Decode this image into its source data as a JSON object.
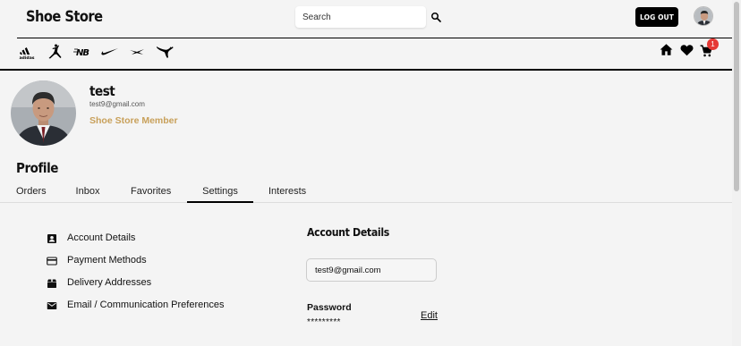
{
  "header": {
    "logo": "Shoe Store",
    "search_placeholder": "Search",
    "logout_label": "LOG OUT"
  },
  "brands": [
    {
      "name": "adidas",
      "icon": "adidas-logo",
      "text": "adidas"
    },
    {
      "name": "jordan",
      "icon": "jumpman-logo"
    },
    {
      "name": "new-balance",
      "icon": "new-balance-logo",
      "text": "NB"
    },
    {
      "name": "nike",
      "icon": "nike-swoosh-logo"
    },
    {
      "name": "reebok",
      "icon": "reebok-logo"
    },
    {
      "name": "puma",
      "icon": "puma-logo"
    }
  ],
  "nav_icons": [
    "home-icon",
    "heart-icon",
    "cart-icon"
  ],
  "cart_count": "1",
  "user": {
    "name": "test",
    "email": "test9@gmail.com",
    "membership": "Shoe Store Member"
  },
  "page_title": "Profile",
  "tabs": [
    {
      "label": "Orders",
      "active": false
    },
    {
      "label": "Inbox",
      "active": false
    },
    {
      "label": "Favorites",
      "active": false
    },
    {
      "label": "Settings",
      "active": true
    },
    {
      "label": "Interests",
      "active": false
    }
  ],
  "settings_menu": [
    {
      "label": "Account Details",
      "icon": "account-box-icon"
    },
    {
      "label": "Payment Methods",
      "icon": "credit-card-icon"
    },
    {
      "label": "Delivery Addresses",
      "icon": "package-icon"
    },
    {
      "label": "Email / Communication Preferences",
      "icon": "mail-icon"
    }
  ],
  "account_details": {
    "title": "Account Details",
    "email_value": "test9@gmail.com",
    "password_label": "Password",
    "password_value": "*********",
    "edit_label": "Edit"
  },
  "colors": {
    "accent_gold": "#c8a05a",
    "badge_red": "#e53935",
    "background": "#f4f4f4"
  }
}
